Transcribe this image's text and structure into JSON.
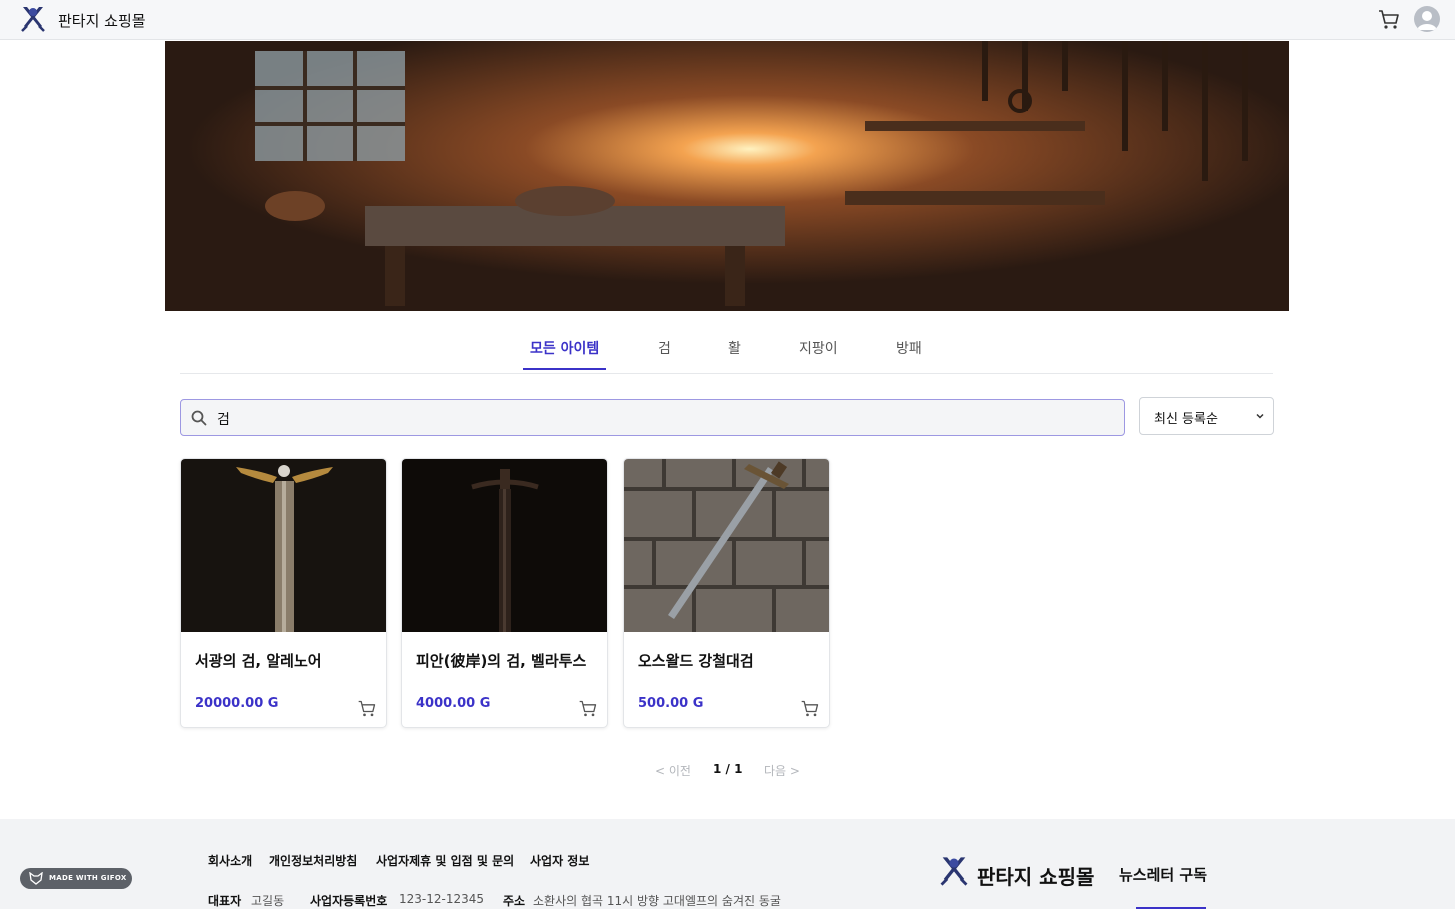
{
  "header": {
    "brand": "판타지 쇼핑몰",
    "icons": [
      "sword-logo-icon",
      "cart-icon",
      "user-avatar-icon"
    ]
  },
  "categories": {
    "tabs": [
      {
        "label": "모든 아이템",
        "active": true
      },
      {
        "label": "검",
        "active": false
      },
      {
        "label": "활",
        "active": false
      },
      {
        "label": "지팡이",
        "active": false
      },
      {
        "label": "방패",
        "active": false
      }
    ]
  },
  "search": {
    "value": "검",
    "icon": "search-icon"
  },
  "sort": {
    "selected": "최신 등록순",
    "icon": "chevron-down-icon"
  },
  "products": [
    {
      "name": "서광의 검, 알레노어",
      "price": "20000.00 G"
    },
    {
      "name": "피안(彼岸)의 검, 벨라투스",
      "price": "4000.00 G"
    },
    {
      "name": "오스왈드 강철대검",
      "price": "500.00 G"
    }
  ],
  "pagination": {
    "prev": "< 이전",
    "current": "1 / 1",
    "next": "다음 >"
  },
  "footer": {
    "links": [
      "회사소개",
      "개인정보처리방침",
      "사업자제휴 및 입점 및 문의",
      "사업자 정보"
    ],
    "info": [
      {
        "label": "대표자",
        "value": "고길동"
      },
      {
        "label": "사업자등록번호",
        "value": "123-12-12345"
      },
      {
        "label": "주소",
        "value": "소환사의 협곡 11시 방향 고대엘프의 숨겨진 동굴"
      }
    ],
    "brand": "판타지 쇼핑몰",
    "newsletter": "뉴스레터 구독"
  },
  "badge": {
    "label": "MADE WITH GIFOX"
  },
  "colors": {
    "accent": "#3b32c8",
    "footer_bg": "#f2f3f5"
  }
}
